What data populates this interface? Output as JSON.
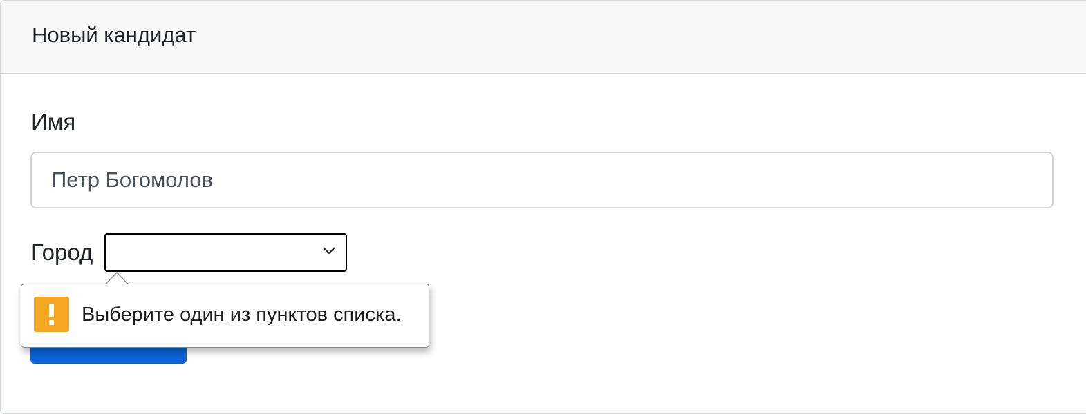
{
  "card": {
    "title": "Новый кандидат"
  },
  "form": {
    "name_label": "Имя",
    "name_value": "Петр Богомолов",
    "city_label": "Город",
    "city_value": "",
    "submit_label": ""
  },
  "validation_tooltip": {
    "message": "Выберите один из пунктов списка.",
    "icon": "warning-icon"
  },
  "colors": {
    "primary_button": "#0b63d4",
    "warning": "#f5a623",
    "header_bg": "#f7f7f7"
  }
}
